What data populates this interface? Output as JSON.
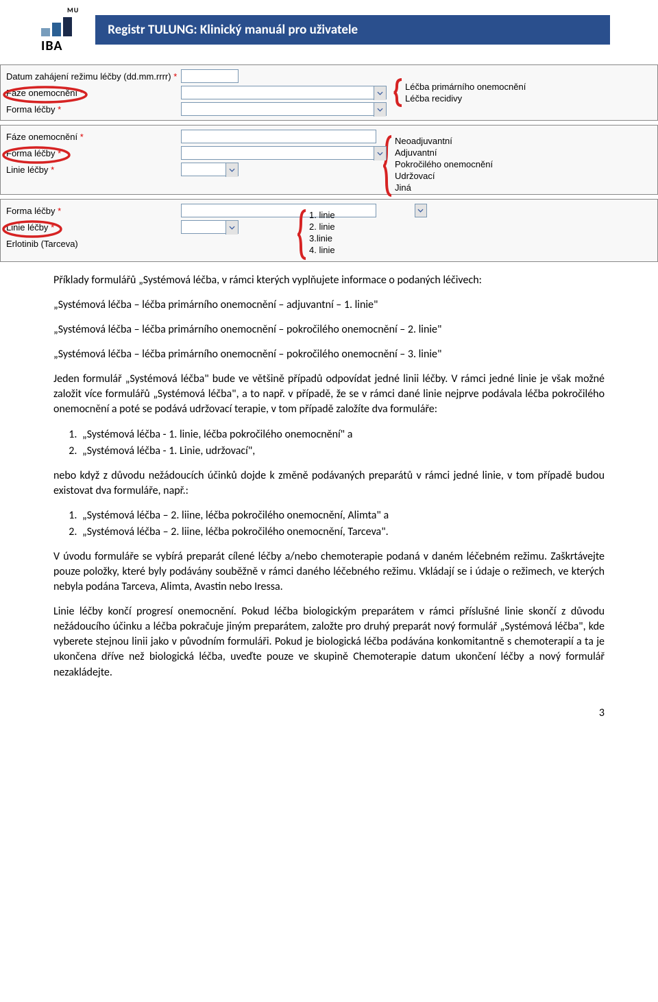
{
  "header": {
    "mu": "MU",
    "iba": "IBA",
    "title": "Registr TULUNG: Klinický manuál pro uživatele"
  },
  "block1": {
    "r1_label": "Datum zahájení režimu léčby (dd.mm.rrrr)",
    "r2_label": "Fáze onemocnění",
    "r3_label": "Forma léčby",
    "opt1": "Léčba primárního onemocnění",
    "opt2": "Léčba recidivy"
  },
  "block2": {
    "r1_label": "Fáze onemocnění",
    "r2_label": "Forma léčby",
    "r3_label": "Linie léčby",
    "opt1": "Neoadjuvantní",
    "opt2": "Adjuvantní",
    "opt3": "Pokročilého onemocnění",
    "opt4": "Udržovací",
    "opt5": "Jiná"
  },
  "block3": {
    "r1_label": "Forma léčby",
    "r2_label": "Linie léčby",
    "r3_label": "Erlotinib (Tarceva)",
    "opt1": "1. linie",
    "opt2": "2. linie",
    "opt3": "3.linie",
    "opt4": "4. linie"
  },
  "content": {
    "p1": "Příklady formulářů „Systémová léčba, v rámci kterých vyplňujete informace o podaných léčivech:",
    "p2": "„Systémová léčba – léčba primárního onemocnění – adjuvantní – 1. linie\"",
    "p3": "„Systémová léčba – léčba primárního onemocnění – pokročilého onemocnění – 2. linie\"",
    "p4": "„Systémová léčba – léčba primárního onemocnění – pokročilého onemocnění – 3. linie\"",
    "p5": "Jeden formulář „Systémová léčba\" bude ve většině případů odpovídat jedné linii léčby. V rámci jedné linie je však možné založit více formulářů „Systémová léčba\", a to např. v případě, že se v rámci dané linie nejprve podávala léčba pokročilého onemocnění a poté se podává udržovací terapie, v tom případě založíte dva formuláře:",
    "li1": "„Systémová léčba - 1. linie, léčba pokročilého onemocnění\" a",
    "li2": "„Systémová léčba - 1. Linie, udržovací\",",
    "p6": "nebo když z důvodu nežádoucích účinků dojde k změně podávaných preparátů v rámci jedné linie, v tom případě budou existovat dva formuláře, např.:",
    "li3": "„Systémová léčba – 2. liine, léčba pokročilého onemocnění, Alimta\" a",
    "li4": "„Systémová léčba – 2. liine, léčba pokročilého onemocnění, Tarceva\".",
    "p7": "V úvodu formuláře se vybírá preparát cílené léčby a/nebo chemoterapie podaná v daném léčebném režimu. Zaškrtávejte pouze položky, které byly podávány souběžně v rámci daného léčebného režimu. Vkládají se i údaje o režimech, ve kterých nebyla podána Tarceva, Alimta, Avastin nebo Iressa.",
    "p8": "Linie léčby končí progresí onemocnění. Pokud léčba biologickým preparátem v rámci příslušné linie skončí z důvodu nežádoucího účinku a léčba pokračuje jiným preparátem, založte pro druhý preparát nový formulář „Systémová léčba\", kde vyberete stejnou linii jako v původním formuláři. Pokud je biologická léčba podávána konkomitantně s chemoterapií a ta je ukončena dříve než biologická léčba, uveďte pouze ve skupině Chemoterapie datum ukončení léčby a nový formulář nezakládejte."
  },
  "page_num": "3"
}
